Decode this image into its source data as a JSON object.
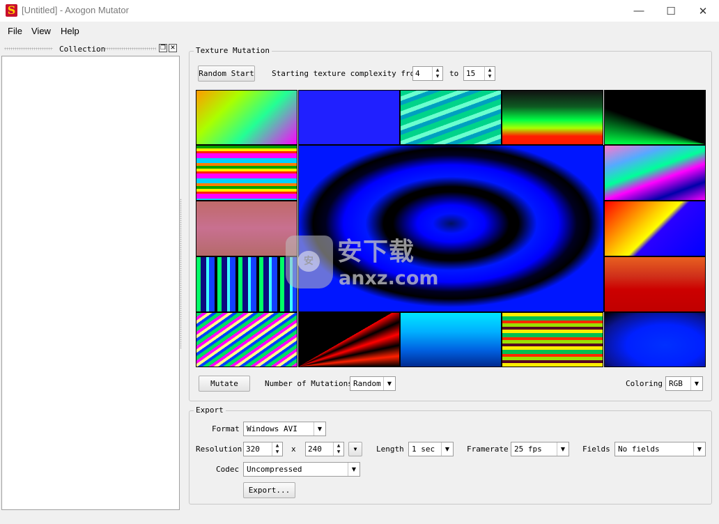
{
  "window": {
    "title": "[Untitled] - Axogon Mutator",
    "minimize_glyph": "—",
    "maximize_glyph": "☐",
    "close_glyph": "✕"
  },
  "menu": [
    "File",
    "View",
    "Help"
  ],
  "collection": {
    "title": "Collection",
    "float_glyph": "❐",
    "close_glyph": "✕"
  },
  "texture_mutation": {
    "legend": "Texture Mutation",
    "random_start_label": "Random Start",
    "complexity_label": "Starting texture complexity from",
    "complexity_from": "4",
    "to_label": "to",
    "complexity_to": "15",
    "mutate_label": "Mutate",
    "mutations_label": "Number of Mutations",
    "mutations_value": "Random",
    "coloring_label": "Coloring",
    "coloring_value": "RGB"
  },
  "export": {
    "legend": "Export",
    "format_label": "Format",
    "format_value": "Windows AVI",
    "resolution_label": "Resolution",
    "width": "320",
    "x_label": "x",
    "height": "240",
    "length_label": "Length",
    "length_value": "1 sec",
    "framerate_label": "Framerate",
    "framerate_value": "25 fps",
    "fields_label": "Fields",
    "fields_value": "No fields",
    "codec_label": "Codec",
    "codec_value": "Uncompressed",
    "export_button": "Export..."
  },
  "watermark": {
    "cn": "安下载",
    "en": "anxz.com",
    "badge": "安"
  },
  "icons": {
    "spin_up": "▲",
    "spin_down": "▼",
    "combo_arrow": "▼"
  }
}
